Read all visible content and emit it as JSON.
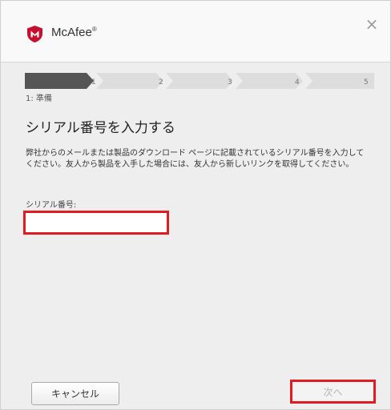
{
  "window": {
    "brand_name": "McAfee",
    "brand_mark": "®",
    "logo_icon": "mcafee-shield-m-icon",
    "close_icon": "close-icon",
    "close_glyph": "×"
  },
  "stepper": {
    "current_step": 1,
    "steps": [
      "1",
      "2",
      "3",
      "4",
      "5"
    ],
    "caption": "1: 準備",
    "active_color": "#555555",
    "inactive_color": "#dddddd"
  },
  "main": {
    "title": "シリアル番号を入力する",
    "description": "弊社からのメールまたは製品のダウンロード ページに記載されているシリアル番号を入力してください。友人から製品を入手した場合には、友人から新しいリンクを取得してください。",
    "serial_label": "シリアル番号:",
    "serial_value": "",
    "serial_placeholder": ""
  },
  "footer": {
    "cancel_label": "キャンセル",
    "next_label": "次へ"
  },
  "colors": {
    "brand_red": "#c8102e",
    "highlight_red": "#e11b22"
  }
}
